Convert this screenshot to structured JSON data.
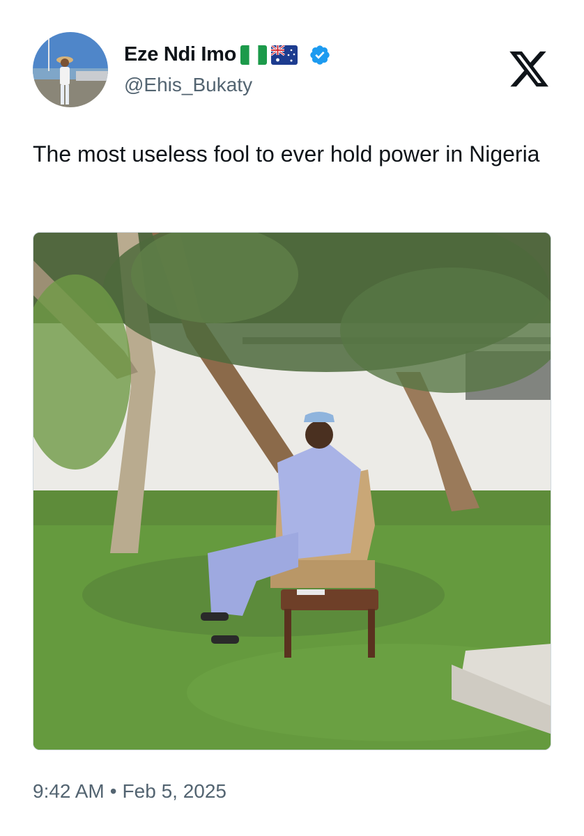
{
  "author": {
    "display_name": "Eze Ndi Imo",
    "handle": "@Ehis_Bukaty",
    "flags": [
      "nigeria-flag-icon",
      "australia-flag-icon"
    ],
    "verified_color": "#1d9bf0"
  },
  "brand": {
    "logo": "x-logo-icon"
  },
  "tweet": {
    "text": "The most useless fool to ever hold power in Nigeria",
    "time": "9:42 AM",
    "separator": "•",
    "date": "Feb 5, 2025"
  },
  "colors": {
    "text": "#0f1419",
    "secondary": "#536471",
    "grass": "#5e8c3a",
    "wall": "#ecebe7",
    "robe": "#a9b3e6"
  }
}
